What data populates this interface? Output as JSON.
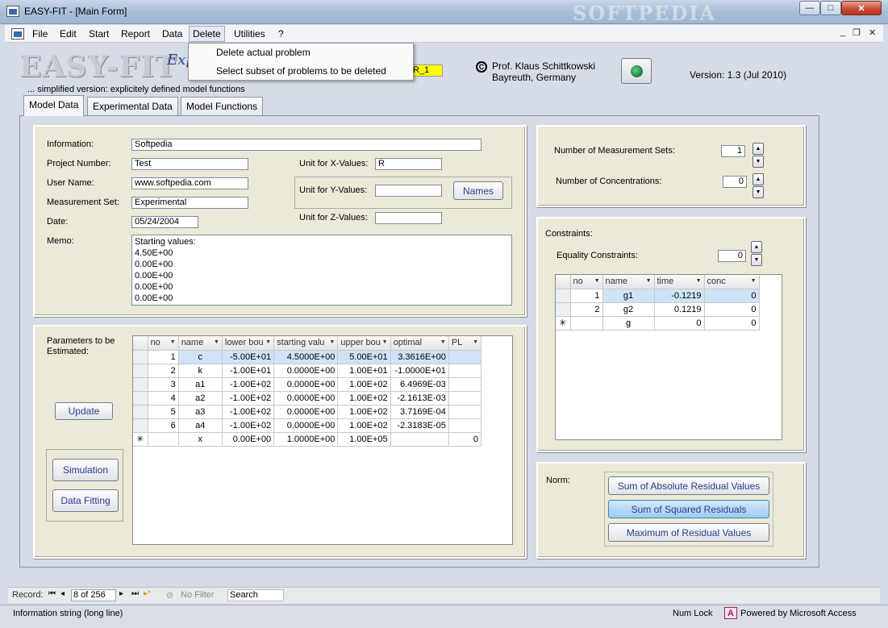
{
  "window": {
    "title": "EASY-FIT - [Main Form]",
    "watermark": "SOFTPEDIA",
    "min": "—",
    "max": "□",
    "close": "✕"
  },
  "menu": {
    "items": [
      "File",
      "Edit",
      "Start",
      "Report",
      "Data",
      "Delete",
      "Utilities",
      "?"
    ],
    "mdi_min": "_",
    "mdi_restore": "❐",
    "mdi_close": "✕"
  },
  "dropdown": {
    "items": [
      "Delete actual problem",
      "Select subset of problems to be deleted"
    ]
  },
  "header": {
    "logo": "EASY-FIT",
    "logo_sub": "Exp",
    "subtitle": "... simplified version: explicitely defined model functions",
    "badge": "R_1",
    "copyright": "C",
    "author_line1": "Prof. Klaus Schittkowski",
    "author_line2": "Bayreuth, Germany",
    "version": "Version:  1.3 (Jul 2010)"
  },
  "tabs": [
    "Model Data",
    "Experimental Data",
    "Model Functions"
  ],
  "model": {
    "information_label": "Information:",
    "information": "Softpedia",
    "project_label": "Project Number:",
    "project": "Test",
    "user_label": "User Name:",
    "user": "www.softpedia.com",
    "measurement_label": "Measurement Set:",
    "measurement": "Experimental",
    "date_label": "Date:",
    "date": "05/24/2004",
    "memo_label": "Memo:",
    "memo": [
      "Starting values:",
      "4.50E+00",
      "0.00E+00",
      "0.00E+00",
      "0.00E+00",
      "0.00E+00"
    ],
    "unit_x_label": "Unit for X-Values:",
    "unit_x": "R",
    "unit_y_label": "Unit for Y-Values:",
    "unit_y": "",
    "unit_z_label": "Unit for Z-Values:",
    "unit_z": "",
    "names_button": "Names"
  },
  "params": {
    "label": "Parameters to be Estimated:",
    "update_button": "Update",
    "simulation_button": "Simulation",
    "fitting_button": "Data Fitting",
    "columns": [
      "no",
      "name",
      "lower bou",
      "starting valu",
      "upper bou",
      "optimal",
      "PL"
    ],
    "rows": [
      [
        "1",
        "c",
        "-5.00E+01",
        "4.5000E+00",
        "5.00E+01",
        "3.3616E+00",
        ""
      ],
      [
        "2",
        "k",
        "-1.00E+01",
        "0.0000E+00",
        "1.00E+01",
        "-1.0000E+01",
        ""
      ],
      [
        "3",
        "a1",
        "-1.00E+02",
        "0.0000E+00",
        "1.00E+02",
        "6.4969E-03",
        ""
      ],
      [
        "4",
        "a2",
        "-1.00E+02",
        "0.0000E+00",
        "1.00E+02",
        "-2.1613E-03",
        ""
      ],
      [
        "5",
        "a3",
        "-1.00E+02",
        "0.0000E+00",
        "1.00E+02",
        "3.7169E-04",
        ""
      ],
      [
        "6",
        "a4",
        "-1.00E+02",
        "0.0000E+00",
        "1.00E+02",
        "-2.3183E-05",
        ""
      ]
    ],
    "new_row": [
      "✳",
      "",
      "x",
      "0.00E+00",
      "1.0000E+00",
      "1.00E+05",
      "",
      "0"
    ]
  },
  "sets": {
    "measurement_label": "Number of Measurement Sets:",
    "measurement": "1",
    "concentrations_label": "Number of Concentrations:",
    "concentrations": "0"
  },
  "constraints": {
    "label": "Constraints:",
    "equality_label": "Equality Constraints:",
    "equality": "0",
    "columns": [
      "no",
      "name",
      "time",
      "conc"
    ],
    "rows": [
      [
        "1",
        "g1",
        "-0.1219",
        "0"
      ],
      [
        "2",
        "g2",
        "0.1219",
        "0"
      ]
    ],
    "new_row": [
      "✳",
      "",
      "g",
      "0",
      "0"
    ]
  },
  "norm": {
    "label": "Norm:",
    "options": [
      "Sum of Absolute Residual Values",
      "Sum of Squared Residuals",
      "Maximum of Residual Values"
    ]
  },
  "recnav": {
    "record_label": "Record:",
    "first": "⏮",
    "prev": "◂",
    "position": "8 of 256",
    "next": "▸",
    "last": "⏭",
    "new": "▸*",
    "filter": "No Filter",
    "search": "Search"
  },
  "status": {
    "text": "Information string (long line)",
    "numlock": "Num Lock",
    "access_icon": "A",
    "powered": "Powered by Microsoft Access"
  },
  "colors": {
    "panel": "#ece9d8",
    "badge": "#ffff00",
    "selection": "#cfe3f7"
  }
}
